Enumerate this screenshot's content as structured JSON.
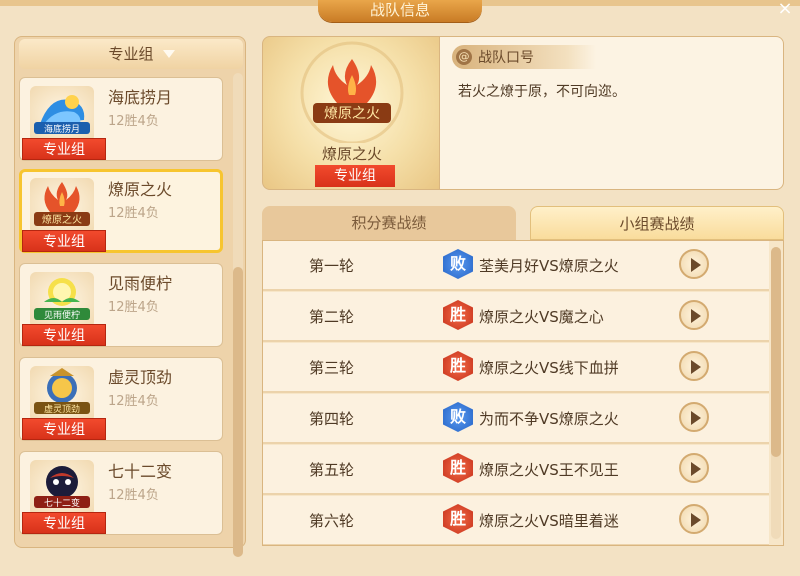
{
  "window": {
    "title": "战队信息",
    "close_label": "×"
  },
  "left": {
    "group_selector": "专业组",
    "teams": [
      {
        "name": "海底捞月",
        "record": "12胜4负",
        "tag": "专业组",
        "logo_text": "海底捞月",
        "logo_color": "#2e8ee3"
      },
      {
        "name": "燎原之火",
        "record": "12胜4负",
        "tag": "专业组",
        "logo_text": "燎原之火",
        "logo_color": "#e5532a",
        "selected": true
      },
      {
        "name": "见雨便柠",
        "record": "12胜4负",
        "tag": "专业组",
        "logo_text": "见雨便柠",
        "logo_color": "#47b54f"
      },
      {
        "name": "虚灵顶劲",
        "record": "12胜4负",
        "tag": "专业组",
        "logo_text": "虚灵顶劲",
        "logo_color": "#c8932c"
      },
      {
        "name": "七十二变",
        "record": "12胜4负",
        "tag": "专业组",
        "logo_text": "七十二变",
        "logo_color": "#c0392b"
      }
    ]
  },
  "team_info": {
    "name": "燎原之火",
    "tag": "专业组",
    "logo_text": "燎原之火",
    "slogan_header": "战队口号",
    "slogan": "若火之燎于原，不可向迩。"
  },
  "tabs": {
    "points": "积分赛战绩",
    "group": "小组赛战绩",
    "active": "group"
  },
  "matches": [
    {
      "round": "第一轮",
      "result": "败",
      "result_type": "lose",
      "text": "荃美月好VS燎原之火"
    },
    {
      "round": "第二轮",
      "result": "胜",
      "result_type": "win",
      "text": "燎原之火VS魔之心"
    },
    {
      "round": "第三轮",
      "result": "胜",
      "result_type": "win",
      "text": "燎原之火VS线下血拼"
    },
    {
      "round": "第四轮",
      "result": "败",
      "result_type": "lose",
      "text": "为而不争VS燎原之火"
    },
    {
      "round": "第五轮",
      "result": "胜",
      "result_type": "win",
      "text": "燎原之火VS王不见王"
    },
    {
      "round": "第六轮",
      "result": "胜",
      "result_type": "win",
      "text": "燎原之火VS暗里着迷"
    }
  ],
  "colors": {
    "win": "#d8321a",
    "lose": "#2463c6",
    "accent": "#f7c52f"
  }
}
